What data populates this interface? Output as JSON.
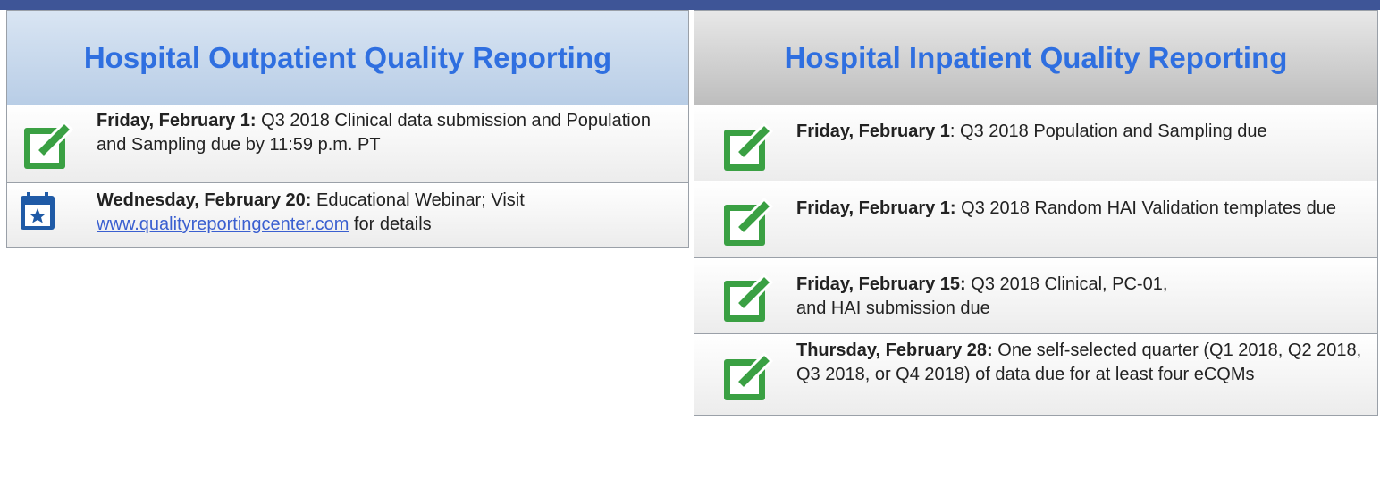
{
  "outpatient": {
    "title": "Hospital Outpatient Quality Reporting",
    "items": [
      {
        "icon": "edit-icon",
        "date": "Friday, February 1:",
        "text": "Q3 2018 Clinical data submission and Population and Sampling due by 11:59 p.m. PT"
      },
      {
        "icon": "calendar-icon",
        "date": "Wednesday, February 20:",
        "text_before": "Educational Webinar; Visit",
        "link": "www.qualityreportingcenter.com",
        "text_after": "for details"
      }
    ]
  },
  "inpatient": {
    "title": "Hospital Inpatient Quality Reporting",
    "items": [
      {
        "icon": "edit-icon",
        "date": "Friday, February 1",
        "text": ": Q3 2018 Population and Sampling due"
      },
      {
        "icon": "edit-icon",
        "date": "Friday, February 1:",
        "text": "Q3 2018 Random HAI Validation templates due"
      },
      {
        "icon": "edit-icon",
        "date": "Friday, February 15:",
        "text": "Q3 2018 Clinical, PC-01, and HAI submission due"
      },
      {
        "icon": "edit-icon",
        "date": "Thursday, February 28:",
        "text": "One self-selected quarter (Q1 2018, Q2 2018, Q3 2018, or Q4 2018) of data due for at least four eCQMs"
      }
    ]
  },
  "colors": {
    "topbar": "#3e5597",
    "header_text": "#2f6fe0",
    "icon_green": "#3aa043",
    "icon_blue": "#1f5aa6",
    "link": "#3a5fd0"
  }
}
